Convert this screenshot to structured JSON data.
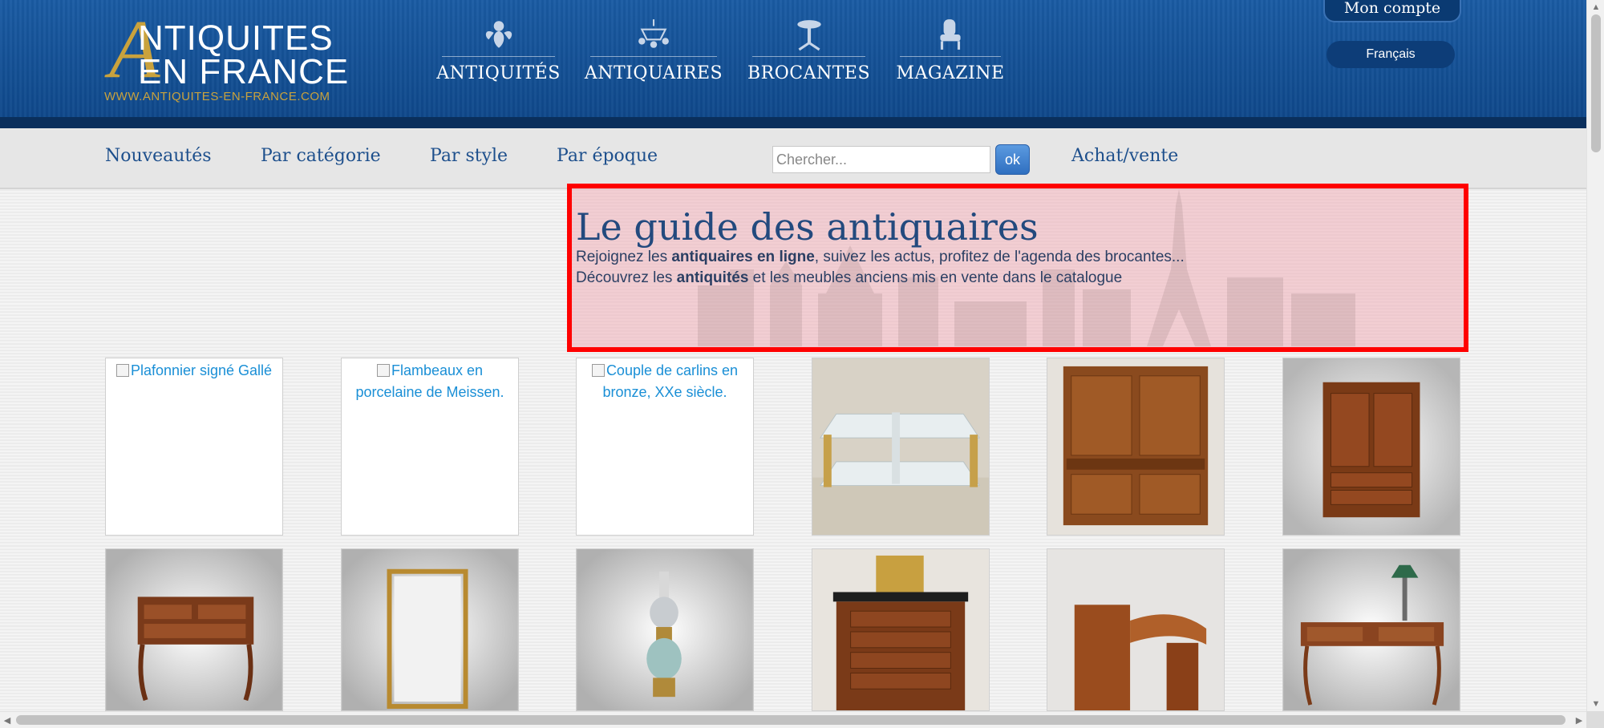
{
  "logo": {
    "line1": "NTIQUITES",
    "line2": "EN FRANCE",
    "big_letter": "A",
    "url": "WWW.ANTIQUITES-EN-FRANCE.COM",
    "gold_color": "#c9a23d"
  },
  "main_nav": {
    "items": [
      {
        "label": "ANTIQUITÉS",
        "icon": "cherub-icon"
      },
      {
        "label": "ANTIQUAIRES",
        "icon": "chandelier-icon"
      },
      {
        "label": "BROCANTES",
        "icon": "pedestal-table-icon"
      },
      {
        "label": "MAGAZINE",
        "icon": "armchair-icon"
      }
    ]
  },
  "account": {
    "label": "Mon compte",
    "language": "Français"
  },
  "subnav": {
    "links": [
      "Nouveautés",
      "Par catégorie",
      "Par style",
      "Par époque"
    ],
    "search_placeholder": "Chercher...",
    "search_button": "ok",
    "trade_link": "Achat/vente"
  },
  "guide": {
    "title": "Le guide des antiquaires",
    "line1_pre": "Rejoignez les ",
    "line1_bold": "antiquaires en ligne",
    "line1_post": ", suivez les actus, profitez de l'agenda des brocantes...",
    "line2_pre": "Découvrez les ",
    "line2_bold": "antiquités",
    "line2_post": " et les meubles anciens mis en vente dans le catalogue",
    "highlight_color": "#ff0000"
  },
  "grid": {
    "row1": [
      {
        "alt": "Plafonnier signé Gallé",
        "broken": true
      },
      {
        "alt": "Flambeaux en porcelaine de Meissen.",
        "broken": true
      },
      {
        "alt": "Couple de carlins en bronze, XXe siècle.",
        "broken": true
      },
      {
        "photo": "glass-brass-coffee-table"
      },
      {
        "photo": "walnut-buffet-deux-corps"
      },
      {
        "photo": "small-walnut-cabinet"
      }
    ],
    "row2": [
      {
        "photo": "marquetry-dressing-table"
      },
      {
        "photo": "gilt-frame-mirror"
      },
      {
        "photo": "oil-lamp"
      },
      {
        "photo": "mahogany-chest-with-clock"
      },
      {
        "photo": "art-deco-desk"
      },
      {
        "photo": "louis-xv-writing-desk"
      }
    ]
  },
  "link_color": "#1a8fd6",
  "nav_text_color": "#1d4f8c"
}
